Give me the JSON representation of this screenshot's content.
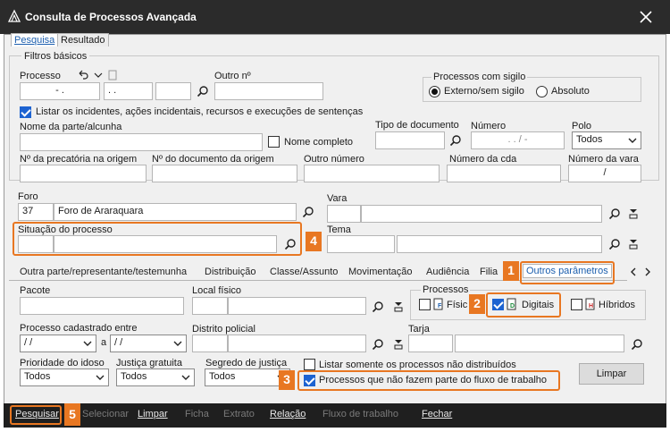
{
  "window": {
    "title": "Consulta de Processos Avançada"
  },
  "tabs": [
    {
      "label": "Pesquisa",
      "active": true
    },
    {
      "label": "Resultado",
      "active": false
    }
  ],
  "filtros": {
    "legend": "Filtros básicos",
    "processo_label": "Processo",
    "processo_parts": [
      "- .",
      ". .",
      "",
      ""
    ],
    "outro_n_label": "Outro nº",
    "sigilo_legend": "Processos com sigilo",
    "sigilo_options": [
      "Externo/sem sigilo",
      "Absoluto"
    ],
    "listar_incidentes_label": "Listar os incidentes, ações incidentais, recursos e execuções de sentenças",
    "nome_parte_label": "Nome da parte/alcunha",
    "nome_completo_label": "Nome completo",
    "tipo_documento_label": "Tipo de documento",
    "numero_label": "Número",
    "numero_value": ". .  /  -",
    "polo_label": "Polo",
    "polo_value": "Todos",
    "precatoria_label": "Nº da precatória na origem",
    "doc_origem_label": "Nº do documento da origem",
    "outro_numero_label": "Outro número",
    "numero_cda_label": "Número da cda",
    "numero_vara_label": "Número da vara",
    "numero_vara_value": "/"
  },
  "foro": {
    "label": "Foro",
    "code": "37",
    "name": "Foro de Araraquara"
  },
  "vara": {
    "label": "Vara"
  },
  "situacao": {
    "label": "Situação do processo"
  },
  "tema": {
    "label": "Tema"
  },
  "subtabs": [
    "Outra parte/representante/testemunha",
    "Distribuição",
    "Classe/Assunto",
    "Movimentação",
    "Audiência",
    "Filia",
    "Outros parâmetros"
  ],
  "outros": {
    "pacote_label": "Pacote",
    "local_fisico_label": "Local físico",
    "processos_legend": "Processos",
    "fisicos_label": "Físic",
    "digitais_label": "Digitais",
    "hibridos_label": "Híbridos",
    "cadastrado_label": "Processo cadastrado entre",
    "date_from": " / /",
    "date_sep": "a",
    "date_to": " / /",
    "distrito_label": "Distrito policial",
    "tarja_label": "Tarja",
    "prioridade_label": "Prioridade do idoso",
    "prioridade_value": "Todos",
    "justica_label": "Justiça gratuita",
    "justica_value": "Todos",
    "segredo_label": "Segredo de justiça",
    "segredo_value": "Todos",
    "nao_distribuidos_label": "Listar somente os processos não distribuídos",
    "fora_fluxo_label": "Processos que não fazem parte do fluxo de trabalho",
    "limpar_btn": "Limpar"
  },
  "badges": [
    "1",
    "2",
    "3",
    "4",
    "5"
  ],
  "toolbar": [
    "Pesquisar",
    "Selecionar",
    "Limpar",
    "Ficha",
    "Extrato",
    "Relação",
    "Fluxo de trabalho",
    "Fechar"
  ],
  "colors": {
    "accent": "#e87722",
    "link": "#1d5fae",
    "check": "#1d63d1"
  }
}
